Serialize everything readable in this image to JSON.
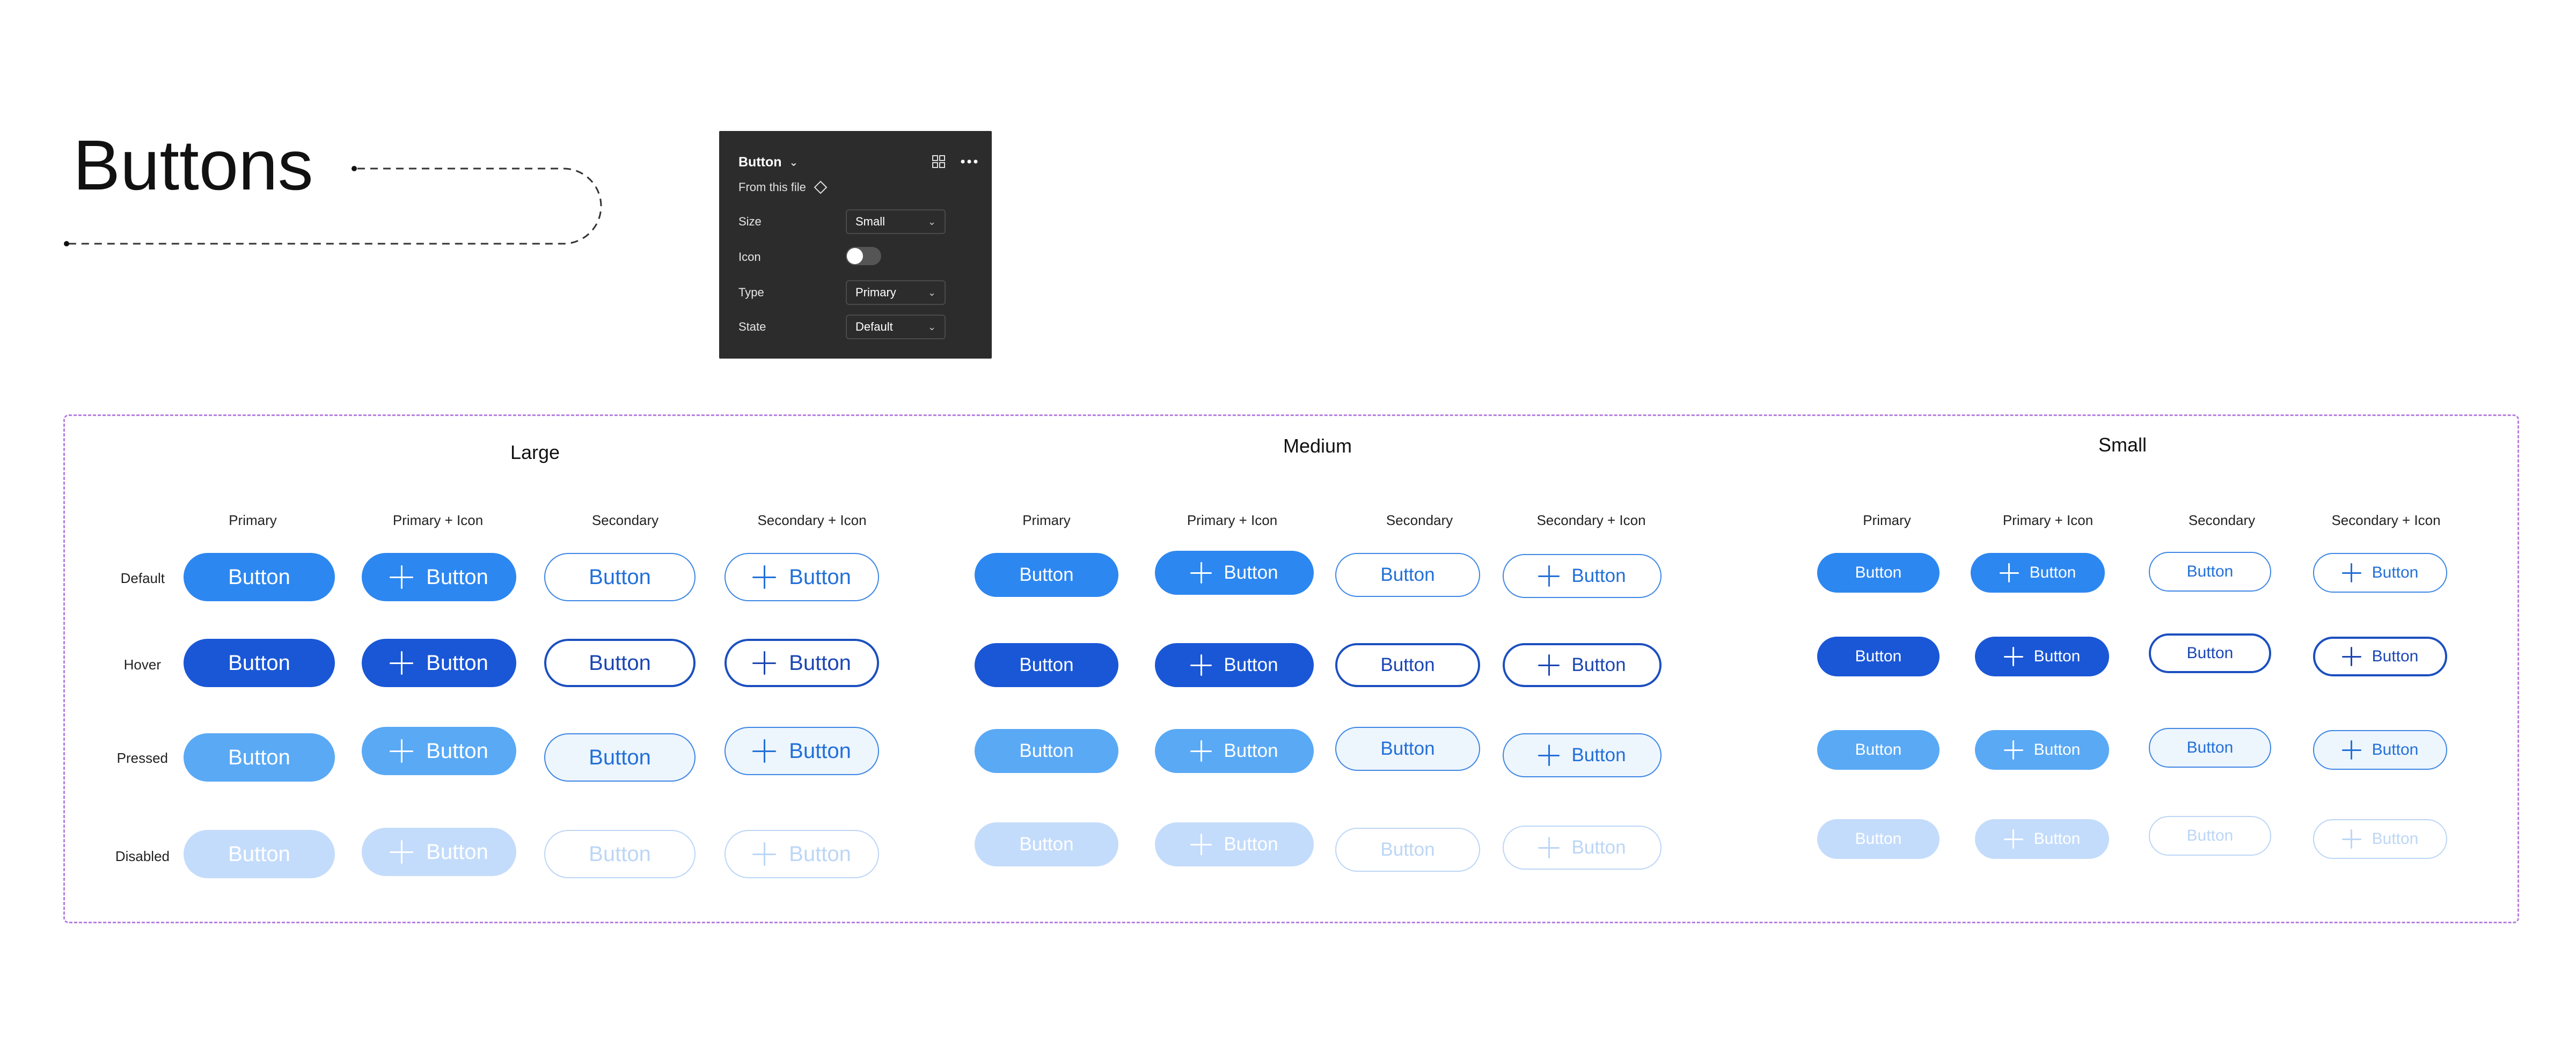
{
  "page": {
    "title": "Buttons"
  },
  "panel": {
    "component_name": "Button",
    "source_label": "From this file",
    "properties": [
      {
        "label": "Size",
        "value": "Small",
        "kind": "select"
      },
      {
        "label": "Icon",
        "value": "off",
        "kind": "toggle"
      },
      {
        "label": "Type",
        "value": "Primary",
        "kind": "select"
      },
      {
        "label": "State",
        "value": "Default",
        "kind": "select"
      }
    ]
  },
  "component_set": {
    "button_label": "Button",
    "columns": [
      "Primary",
      "Primary + Icon",
      "Secondary",
      "Secondary + Icon"
    ],
    "rows": [
      "Default",
      "Hover",
      "Pressed",
      "Disabled"
    ],
    "groups": [
      {
        "name": "Large"
      },
      {
        "name": "Medium"
      },
      {
        "name": "Small"
      }
    ]
  },
  "colors": {
    "primary_default": "#2d87f0",
    "primary_hover": "#1a57d6",
    "primary_pressed": "#5aa9f5",
    "primary_disabled": "#c4dcfb",
    "secondary_text": "#2270d8",
    "secondary_border": "#3d86e4",
    "secondary_hover_border": "#1c4fbf",
    "secondary_pressed_bg": "#edf5fd",
    "secondary_disabled": "#bcd6f6",
    "frame_border": "#b77fe0",
    "panel_bg": "#2c2c2c"
  }
}
